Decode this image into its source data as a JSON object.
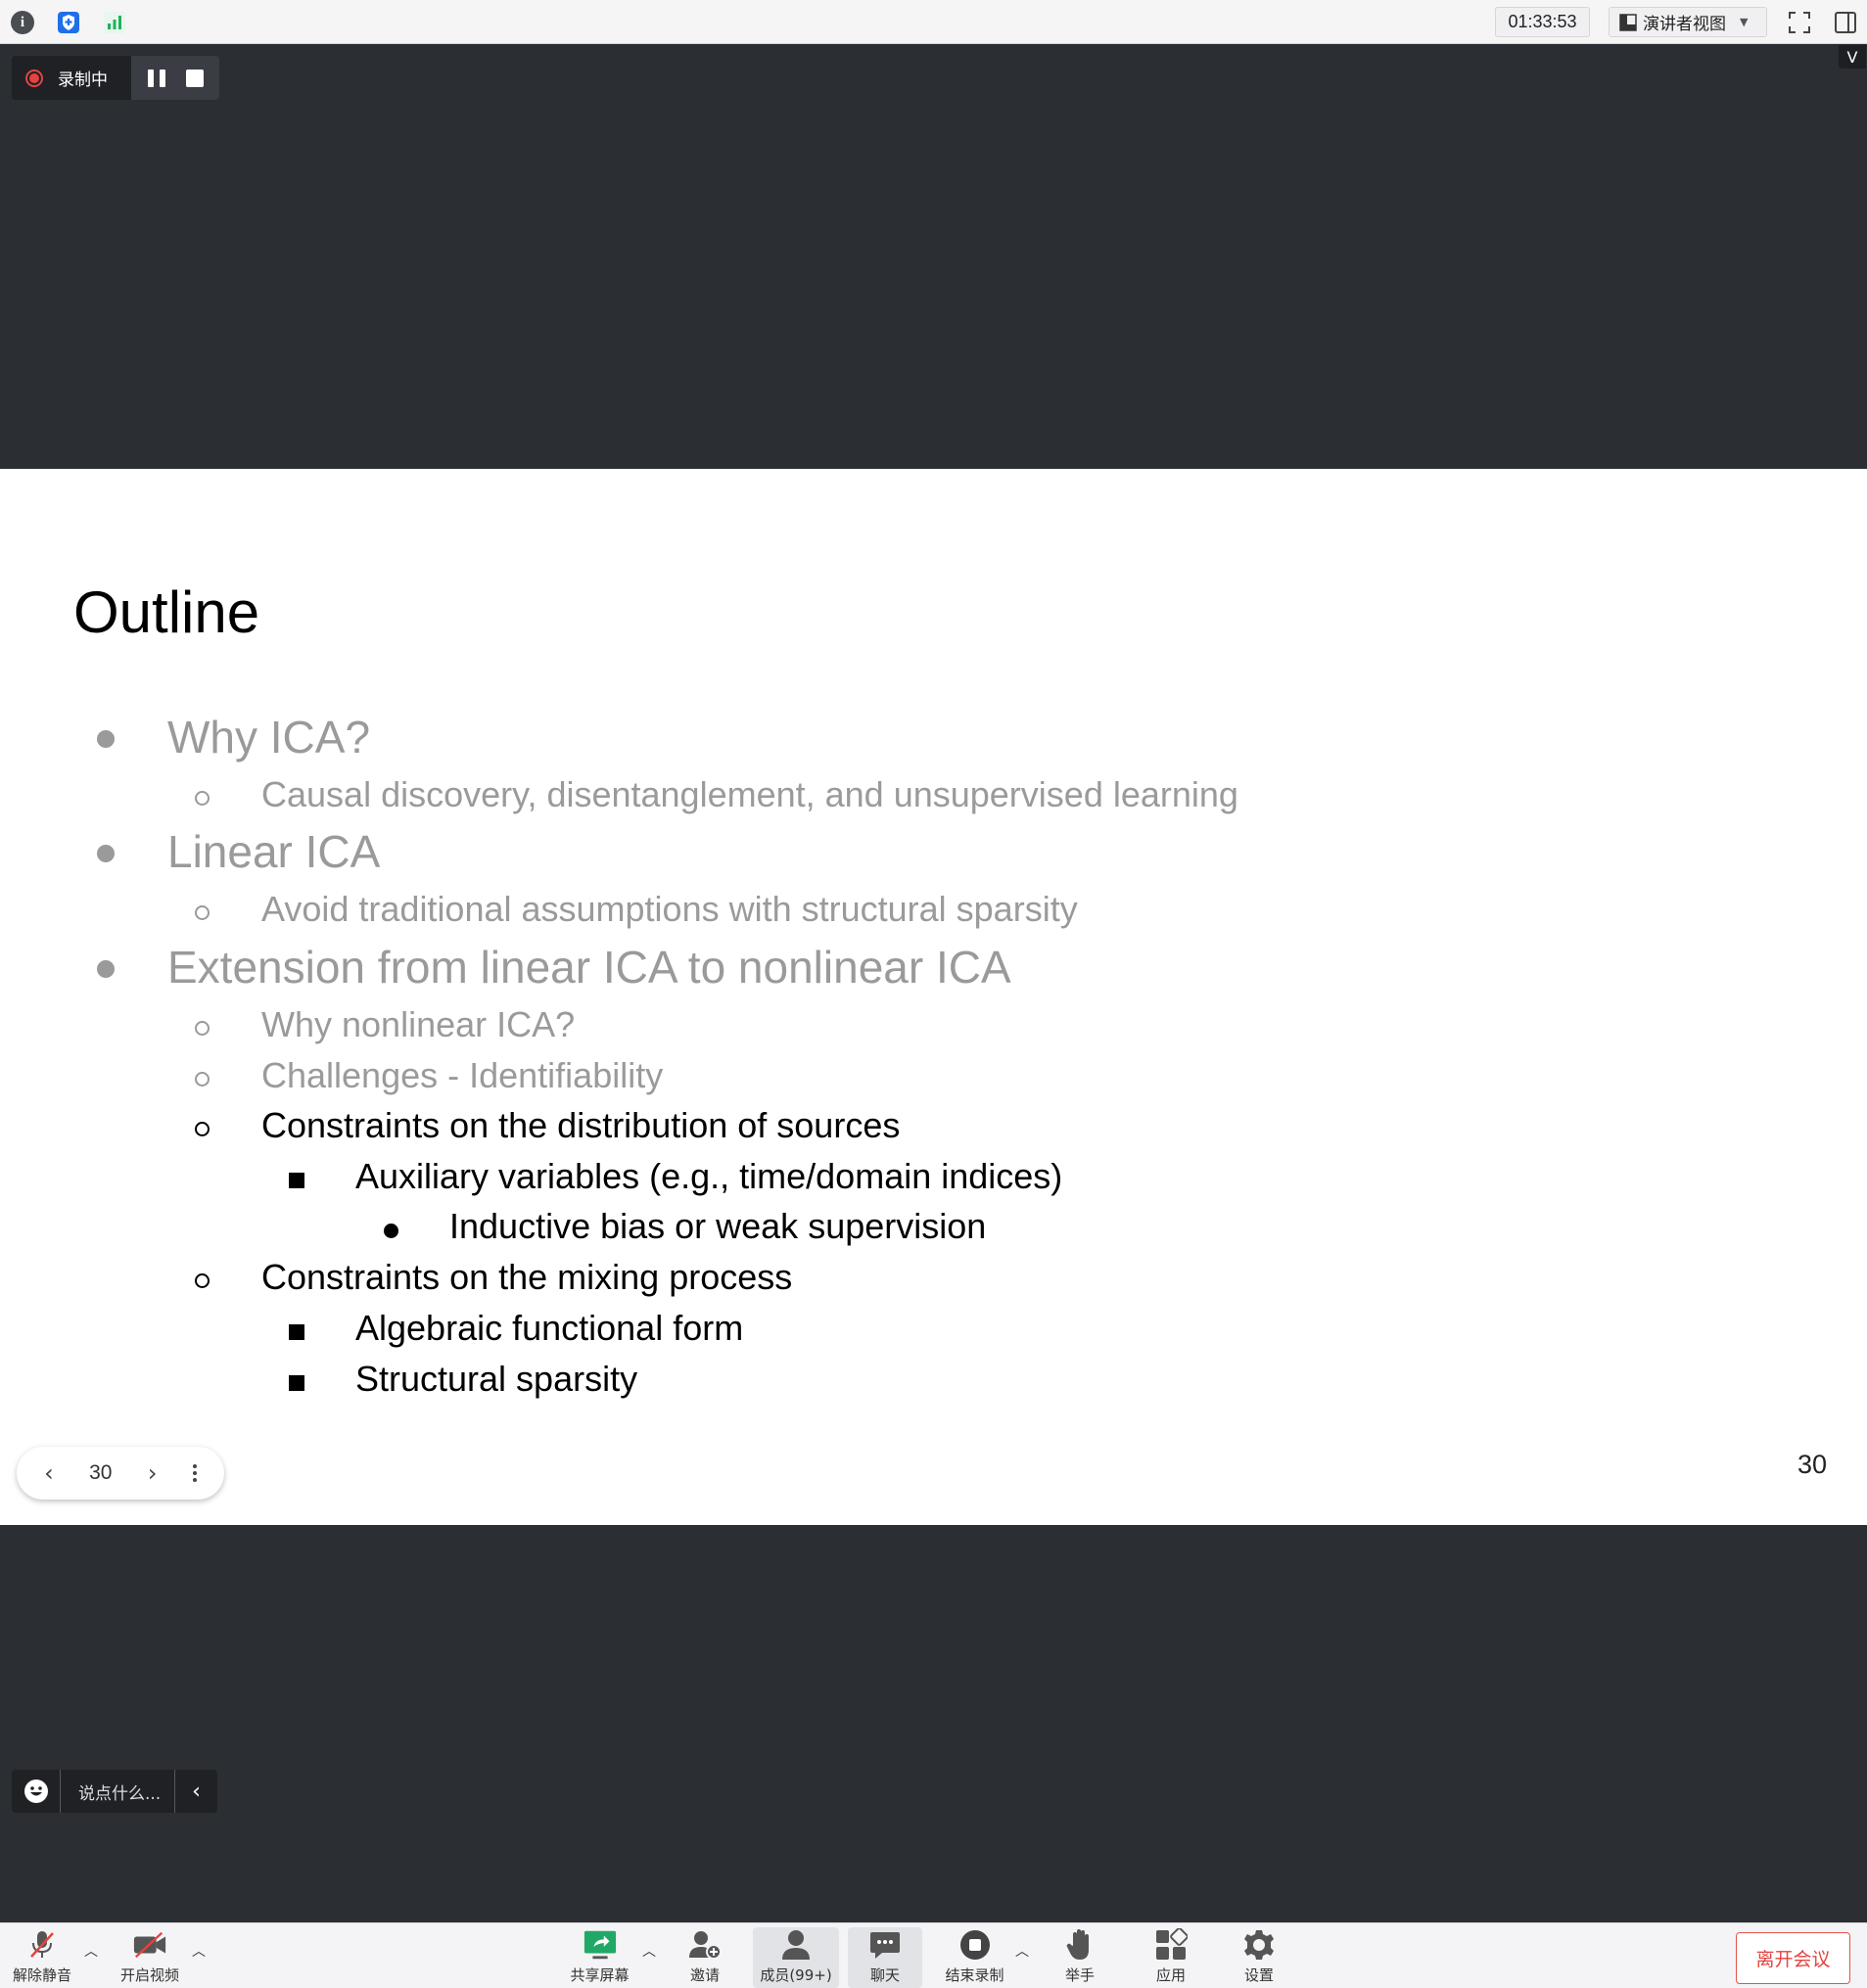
{
  "topbar": {
    "timer": "01:33:53",
    "view_mode": "演讲者视图",
    "collapse_symbol": "V"
  },
  "recording": {
    "status": "录制中"
  },
  "slide": {
    "title": "Outline",
    "page_number": "30",
    "outline": [
      {
        "text": "Why ICA?"
      },
      {
        "text": "Causal discovery, disentanglement, and unsupervised learning"
      },
      {
        "text": "Linear ICA"
      },
      {
        "text": "Avoid traditional assumptions with structural sparsity"
      },
      {
        "text": "Extension from linear ICA to nonlinear ICA"
      },
      {
        "text": "Why nonlinear ICA?"
      },
      {
        "text": "Challenges - Identifiability"
      },
      {
        "text": "Constraints on the distribution of sources"
      },
      {
        "text": "Auxiliary variables (e.g., time/domain indices)"
      },
      {
        "text": "Inductive bias or weak supervision"
      },
      {
        "text": "Constraints on the mixing process"
      },
      {
        "text": "Algebraic functional form"
      },
      {
        "text": "Structural sparsity"
      }
    ]
  },
  "slidenav": {
    "page": "30"
  },
  "reaction": {
    "placeholder": "说点什么..."
  },
  "toolbar": {
    "unmute": "解除静音",
    "start_video": "开启视频",
    "share_screen": "共享屏幕",
    "invite": "邀请",
    "members": "成员(99+)",
    "chat": "聊天",
    "end_recording": "结束录制",
    "raise_hand": "举手",
    "apps": "应用",
    "settings": "设置",
    "leave": "离开会议"
  },
  "colors": {
    "background": "#2b2e33",
    "record_red": "#e5433f",
    "share_green": "#21a867",
    "shield_blue": "#1e6fe8",
    "signal_green": "#22b15a",
    "dim_text": "#9a9a9a"
  }
}
